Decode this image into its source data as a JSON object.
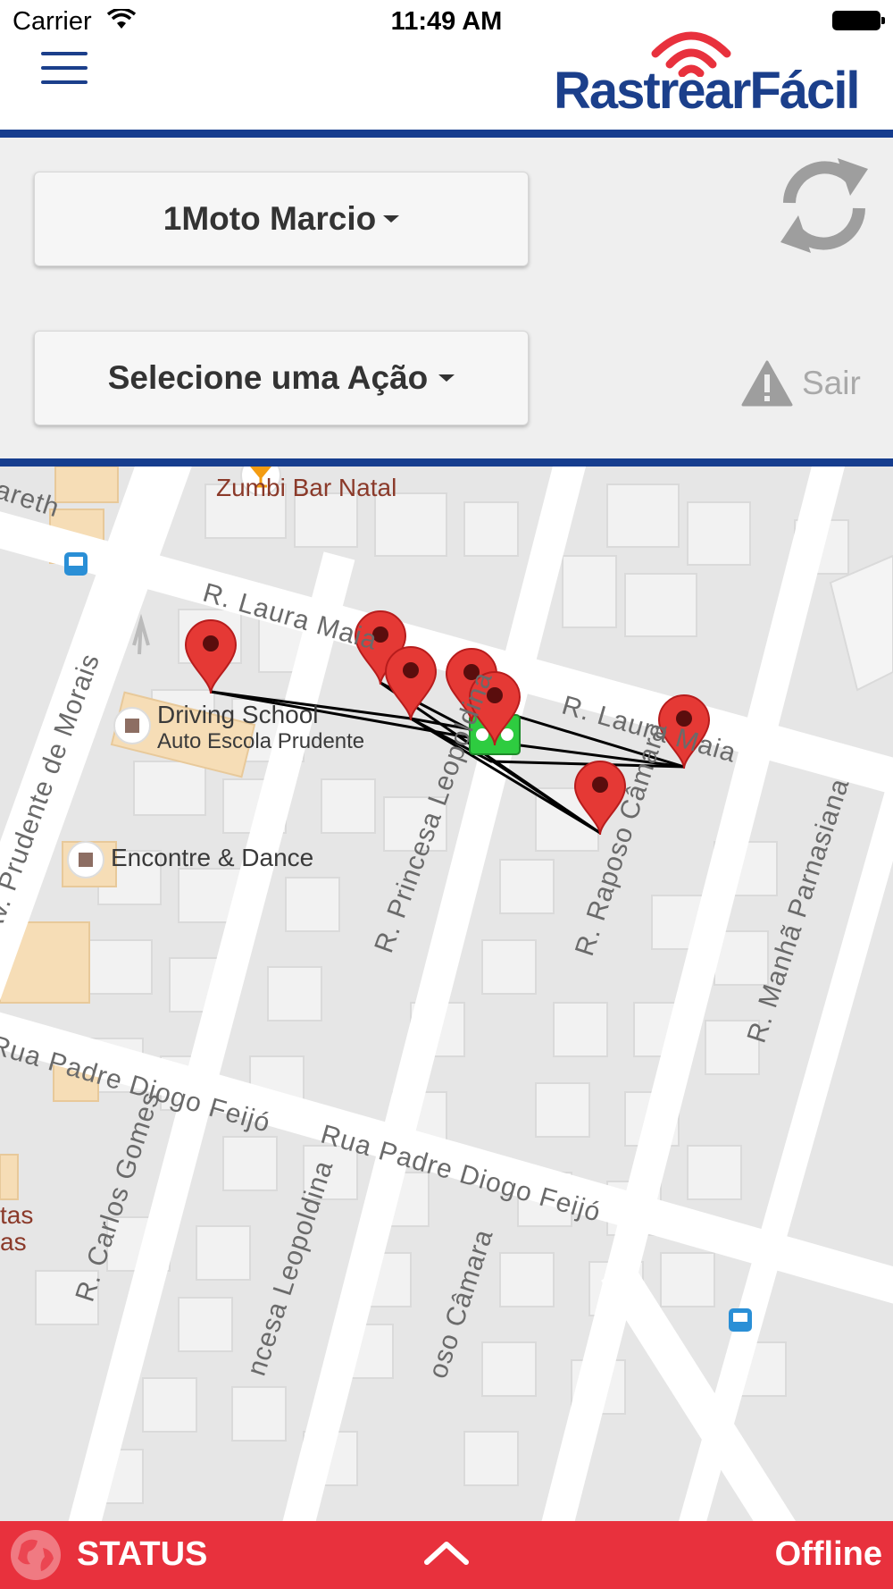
{
  "status_bar": {
    "carrier": "Carrier",
    "time": "11:49 AM"
  },
  "header": {
    "logo_text": "RastrearFácil"
  },
  "controls": {
    "vehicle_select": "1Moto Marcio",
    "action_select": "Selecione uma Ação",
    "logout_label": "Sair"
  },
  "map": {
    "labels": {
      "zumbi": "Zumbi Bar Natal",
      "nazareth": "areth",
      "laura_maia_1": "R. Laura Maia",
      "laura_maia_2": "R. Laura Maia",
      "driving_school": "Driving School",
      "auto_escola": "Auto Escola Prudente",
      "encontre": "Encontre & Dance",
      "prudente_morais": "Av. Prudente de Morais",
      "princesa": "R. Princesa Leopoldina",
      "raposo": "R. Raposo Câmara",
      "manha": "R. Manhã Parnasiana",
      "padre_1": "Rua Padre Diogo Feijó",
      "padre_2": "Rua Padre Diogo Feijó",
      "carlos": "R. Carlos Gomes",
      "princesa_2": "ncesa Leopoldina",
      "raposo_2": "oso Câmara",
      "tas": "tas",
      "as": "as"
    },
    "marker_color": "#e53935",
    "vehicle_color": "#2ecc40"
  },
  "bottom_bar": {
    "status_label": "STATUS",
    "connection": "Offline",
    "color": "#e8313d"
  }
}
